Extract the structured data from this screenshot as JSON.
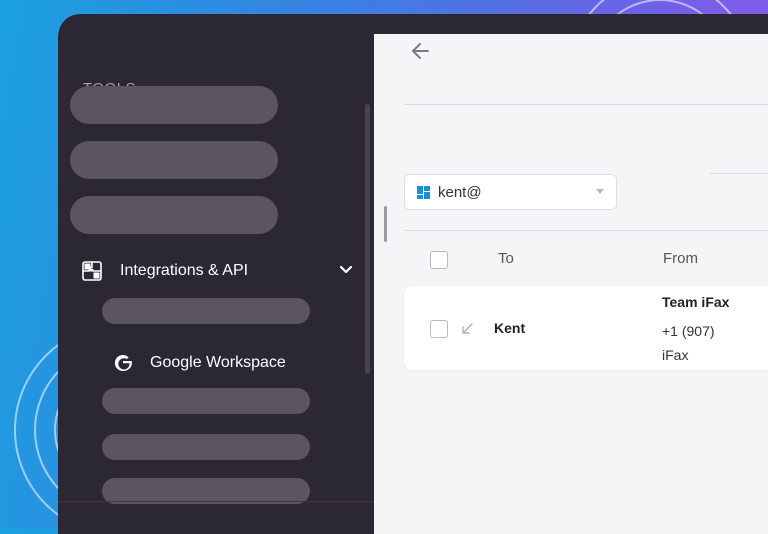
{
  "sidebar": {
    "section_title": "TOOLS",
    "integrations_label": "Integrations & API",
    "google_workspace_label": "Google Workspace"
  },
  "main": {
    "account_select": {
      "value": "kent@"
    },
    "table": {
      "columns": [
        "To",
        "From"
      ],
      "rows": [
        {
          "to": "Kent",
          "from_name": "Team iFax",
          "from_number": "+1 (907)",
          "from_app": "iFax"
        }
      ]
    }
  },
  "colors": {
    "sidebar_bg": "#2c2734",
    "main_bg": "#f5f5f7",
    "accent_blue": "#1aa0e0"
  },
  "icons": [
    "puzzle-icon",
    "chevron-down-icon",
    "google-icon",
    "back-arrow-icon",
    "workspace-icon",
    "caret-down-icon",
    "incoming-arrow-icon"
  ]
}
